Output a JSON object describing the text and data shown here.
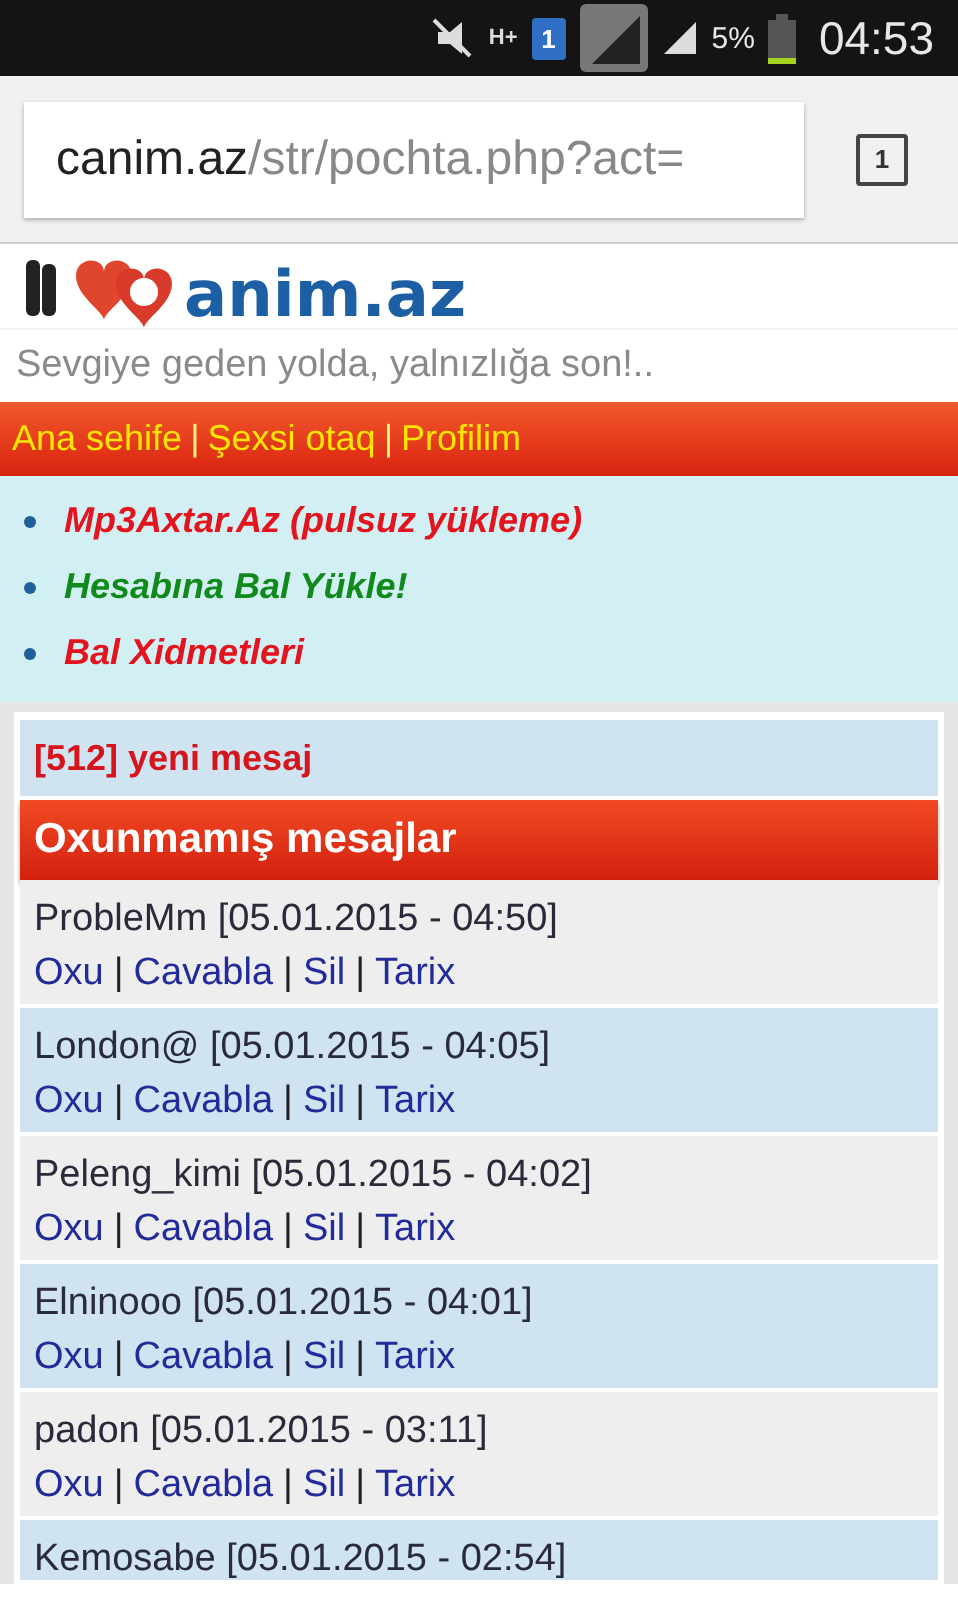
{
  "status_bar": {
    "network": "H+",
    "sim": "1",
    "battery": "5%",
    "time": "04:53"
  },
  "browser": {
    "url_host": "canim.az",
    "url_path": "/str/pochta.php?act=",
    "tab_count": "1"
  },
  "site": {
    "logo": "anim.az",
    "tagline": "Sevgiye geden yolda, yalnızlığa son!.."
  },
  "nav": [
    {
      "kind": "link",
      "label": "Ana sehife"
    },
    {
      "kind": "separator",
      "label": "|"
    },
    {
      "kind": "link",
      "label": "Şexsi otaq"
    },
    {
      "kind": "separator",
      "label": "|"
    },
    {
      "kind": "link",
      "label": "Profilim"
    }
  ],
  "promo_links": [
    {
      "label": "Mp3Axtar.Az (pulsuz yükleme)",
      "color": "#e3141e"
    },
    {
      "label": "Hesabına Bal Yükle!",
      "color": "#118a1c"
    },
    {
      "label": "Bal Xidmetleri",
      "color": "#e3141e"
    }
  ],
  "inbox": {
    "count_text": "[512] yeni mesaj",
    "heading": "Oxunmamış mesajlar",
    "messages": [
      {
        "sender_line": "ProbleMm [05.01.2015 - 04:50]",
        "actions": [
          {
            "kind": "link",
            "label": "Oxu"
          },
          {
            "kind": "separator",
            "label": "|"
          },
          {
            "kind": "link",
            "label": "Cavabla"
          },
          {
            "kind": "separator",
            "label": "|"
          },
          {
            "kind": "link",
            "label": "Sil"
          },
          {
            "kind": "separator",
            "label": "|"
          },
          {
            "kind": "link",
            "label": "Tarix"
          }
        ]
      },
      {
        "sender_line": "London@ [05.01.2015 - 04:05]",
        "actions": [
          {
            "kind": "link",
            "label": "Oxu"
          },
          {
            "kind": "separator",
            "label": "|"
          },
          {
            "kind": "link",
            "label": "Cavabla"
          },
          {
            "kind": "separator",
            "label": "|"
          },
          {
            "kind": "link",
            "label": "Sil"
          },
          {
            "kind": "separator",
            "label": "|"
          },
          {
            "kind": "link",
            "label": "Tarix"
          }
        ]
      },
      {
        "sender_line": "Peleng_kimi [05.01.2015 - 04:02]",
        "actions": [
          {
            "kind": "link",
            "label": "Oxu"
          },
          {
            "kind": "separator",
            "label": "|"
          },
          {
            "kind": "link",
            "label": "Cavabla"
          },
          {
            "kind": "separator",
            "label": "|"
          },
          {
            "kind": "link",
            "label": "Sil"
          },
          {
            "kind": "separator",
            "label": "|"
          },
          {
            "kind": "link",
            "label": "Tarix"
          }
        ]
      },
      {
        "sender_line": "Elninooo [05.01.2015 - 04:01]",
        "actions": [
          {
            "kind": "link",
            "label": "Oxu"
          },
          {
            "kind": "separator",
            "label": "|"
          },
          {
            "kind": "link",
            "label": "Cavabla"
          },
          {
            "kind": "separator",
            "label": "|"
          },
          {
            "kind": "link",
            "label": "Sil"
          },
          {
            "kind": "separator",
            "label": "|"
          },
          {
            "kind": "link",
            "label": "Tarix"
          }
        ]
      },
      {
        "sender_line": "padon [05.01.2015 - 03:11]",
        "actions": [
          {
            "kind": "link",
            "label": "Oxu"
          },
          {
            "kind": "separator",
            "label": "|"
          },
          {
            "kind": "link",
            "label": "Cavabla"
          },
          {
            "kind": "separator",
            "label": "|"
          },
          {
            "kind": "link",
            "label": "Sil"
          },
          {
            "kind": "separator",
            "label": "|"
          },
          {
            "kind": "link",
            "label": "Tarix"
          }
        ]
      },
      {
        "sender_line": "Kemosabe [05.01.2015 - 02:54]"
      }
    ]
  }
}
